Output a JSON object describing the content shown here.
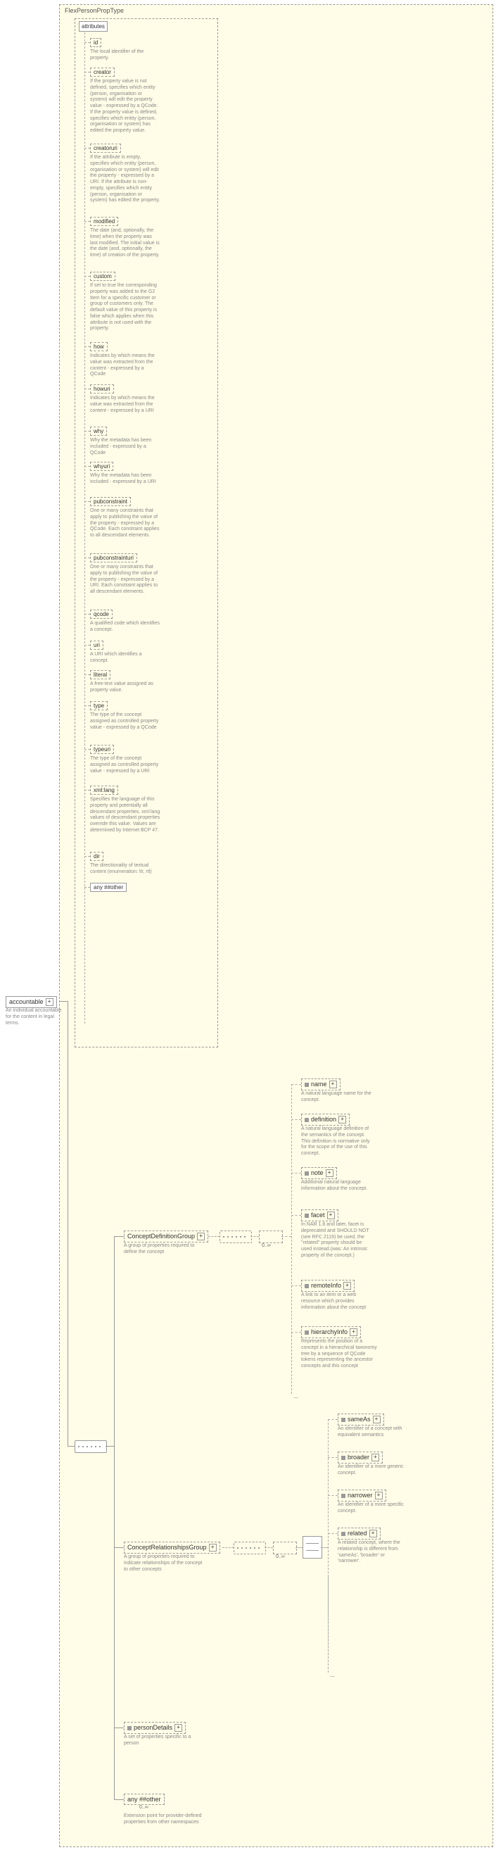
{
  "root": {
    "title": "FlexPersonPropType",
    "element": "accountable",
    "element_desc": "An individual accountable for the content in legal terms."
  },
  "attributes_label": "attributes",
  "attrs": {
    "id": {
      "name": "id",
      "desc": "The local identifier of the property."
    },
    "creator": {
      "name": "creator",
      "desc": "If the property value is not defined, specifies which entity (person, organisation or system) will edit the property value - expressed by a QCode. If the property value is defined, specifies which entity (person, organisation or system) has edited the property value."
    },
    "creatoruri": {
      "name": "creatoruri",
      "desc": "If the attribute is empty, specifies which entity (person, organisation or system) will edit the property - expressed by a URI. If the attribute is non-empty, specifies which entity (person, organisation or system) has edited the property."
    },
    "modified": {
      "name": "modified",
      "desc": "The date (and, optionally, the time) when the property was last modified. The initial value is the date (and, optionally, the time) of creation of the property."
    },
    "custom": {
      "name": "custom",
      "desc": "If set to true the corresponding property was added to the G2 Item for a specific customer or group of customers only. The default value of this property is false which applies when this attribute is not used with the property."
    },
    "how": {
      "name": "how",
      "desc": "Indicates by which means the value was extracted from the content - expressed by a QCode"
    },
    "howuri": {
      "name": "howuri",
      "desc": "Indicates by which means the value was extracted from the content - expressed by a URI"
    },
    "why": {
      "name": "why",
      "desc": "Why the metadata has been included - expressed by a QCode"
    },
    "whyuri": {
      "name": "whyuri",
      "desc": "Why the metadata has been included - expressed by a URI"
    },
    "pubconstraint": {
      "name": "pubconstraint",
      "desc": "One or many constraints that apply to publishing the value of the property - expressed by a QCode. Each constraint applies to all descendant elements."
    },
    "pubconstrainturi": {
      "name": "pubconstrainturi",
      "desc": "One or many constraints that apply to publishing the value of the property - expressed by a URI. Each constraint applies to all descendant elements."
    },
    "qcode": {
      "name": "qcode",
      "desc": "A qualified code which identifies a concept."
    },
    "uri": {
      "name": "uri",
      "desc": "A URI which identifies a concept."
    },
    "literal": {
      "name": "literal",
      "desc": "A free-text value assigned as property value."
    },
    "type": {
      "name": "type",
      "desc": "The type of the concept assigned as controlled property value - expressed by a QCode"
    },
    "typeuri": {
      "name": "typeuri",
      "desc": "The type of the concept assigned as controlled property value - expressed by a URI"
    },
    "xmllang": {
      "name": "xml:lang",
      "desc": "Specifies the language of this property and potentially all descendant properties. xml:lang values of descendant properties override this value. Values are determined by Internet BCP 47."
    },
    "dir": {
      "name": "dir",
      "desc": "The directionality of textual content (enumeration: ltr, rtl)"
    }
  },
  "any_attr": "any ##other",
  "groups": {
    "defn": {
      "name": "ConceptDefinitionGroup",
      "desc": "A group of properties required to define the concept"
    },
    "rel": {
      "name": "ConceptRelationshipsGroup",
      "desc": "A group of properties required to indicate relationships of the concept to other concepts"
    }
  },
  "defn_children": {
    "name": {
      "name": "name",
      "desc": "A natural language name for the concept."
    },
    "definition": {
      "name": "definition",
      "desc": "A natural language definition of the semantics of the concept. This definition is normative only for the scope of the use of this concept."
    },
    "note": {
      "name": "note",
      "desc": "Additional natural language information about the concept."
    },
    "facet": {
      "name": "facet",
      "desc": "In NAR 1.8 and later, facet is deprecated and SHOULD NOT (see RFC 2119) be used, the \"related\" property should be used instead.(was: An intrinsic property of the concept.)"
    },
    "remoteInfo": {
      "name": "remoteInfo",
      "desc": "A link to an item or a web resource which provides information about the concept"
    },
    "hierarchyInfo": {
      "name": "hierarchyInfo",
      "desc": "Represents the position of a concept in a hierarchical taxonomy tree by a sequence of QCode tokens representing the ancestor concepts and this concept"
    }
  },
  "rel_children": {
    "sameAs": {
      "name": "sameAs",
      "desc": "An identifier of a concept with equivalent semantics"
    },
    "broader": {
      "name": "broader",
      "desc": "An identifier of a more generic concept."
    },
    "narrower": {
      "name": "narrower",
      "desc": "An identifier of a more specific concept."
    },
    "related": {
      "name": "related",
      "desc": "A related concept, where the relationship is different from 'sameAs', 'broader' or 'narrower'."
    }
  },
  "pd": {
    "name": "personDetails",
    "desc": "A set of properties specific to a person"
  },
  "anyother": {
    "name": "any ##other",
    "desc": "Extension point for provider-defined properties from other namespaces"
  },
  "occ": "0..∞"
}
